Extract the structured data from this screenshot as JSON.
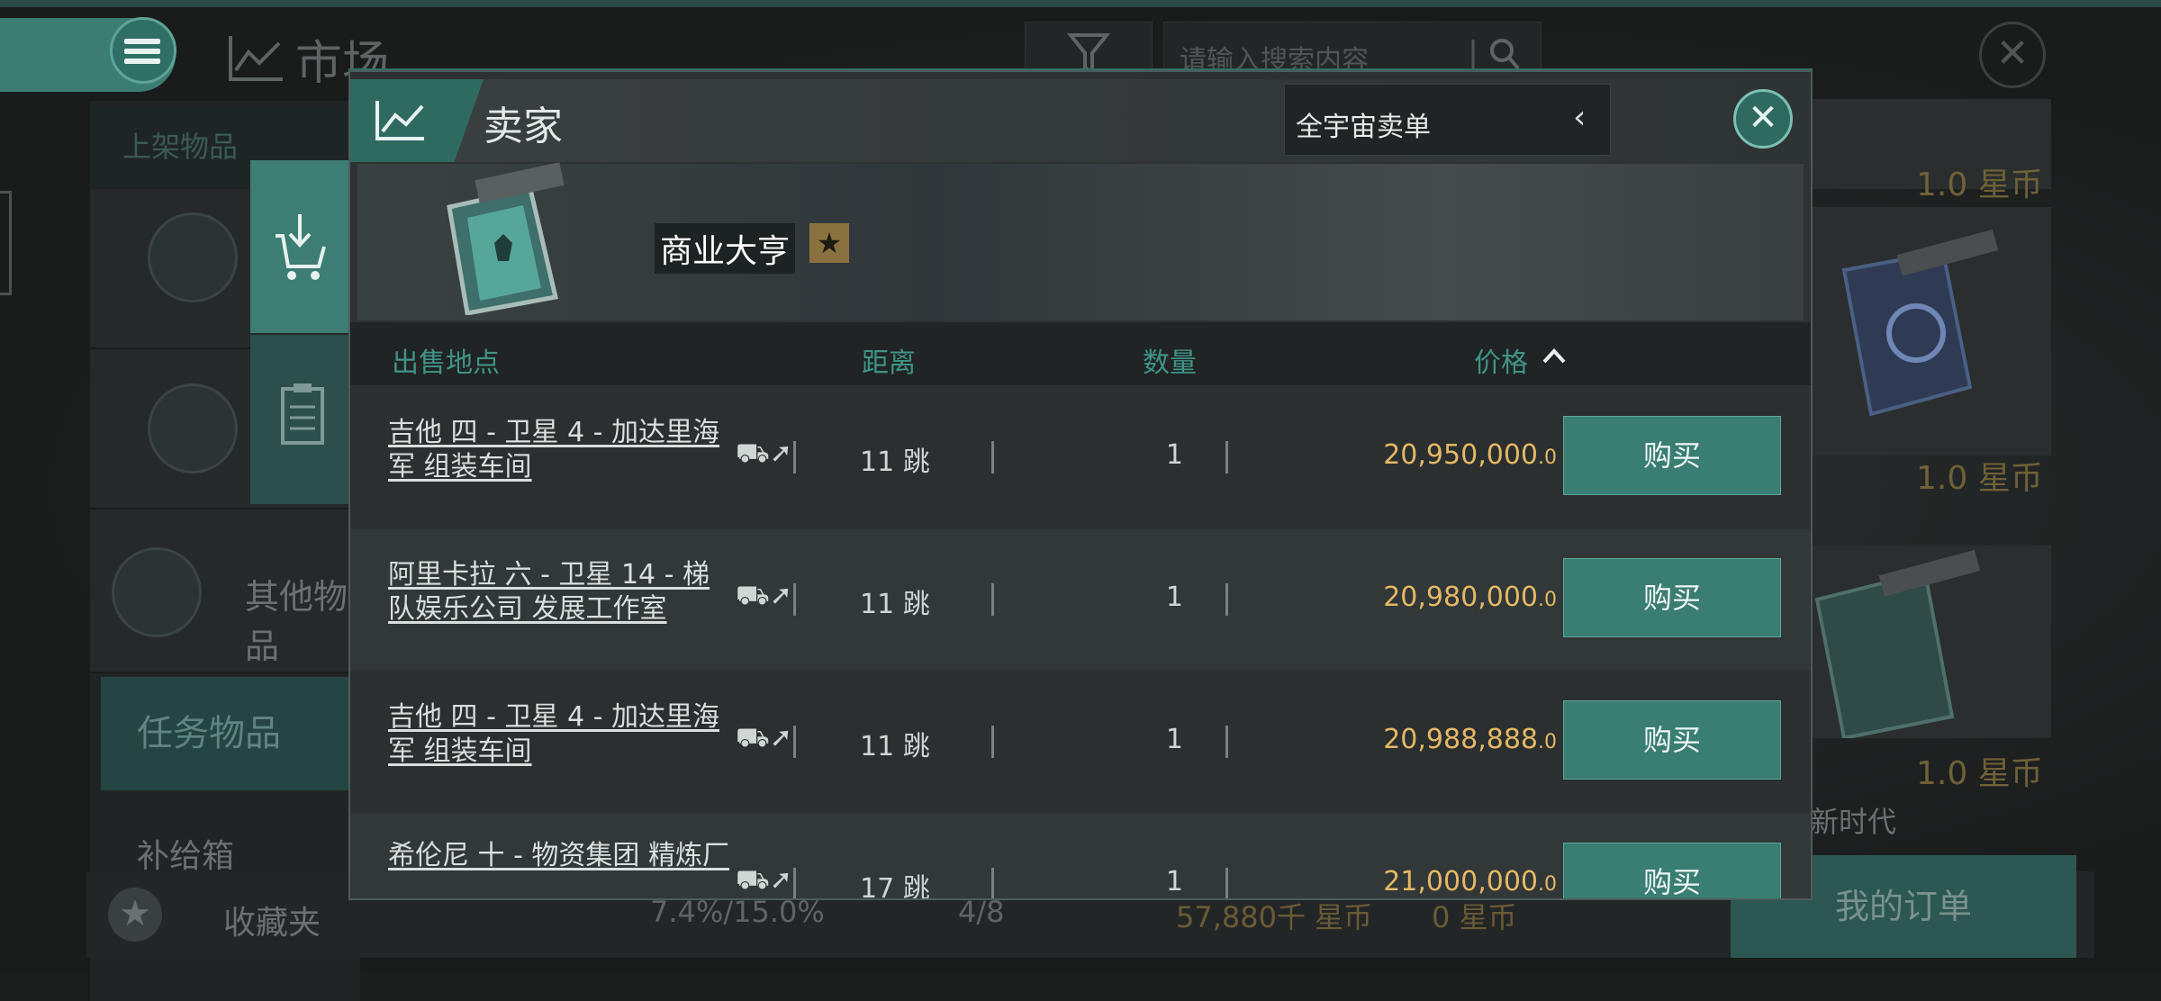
{
  "app": {
    "title": "市场",
    "search": {
      "placeholder": "请输入搜索内容"
    }
  },
  "left_nav": {
    "header": "上架物品",
    "other_items": "其他物品",
    "task_items": "任务物品",
    "supply_box": "补给箱",
    "favorites": "收藏夹"
  },
  "bottom_bar": {
    "tax": "7.4%/15.0%",
    "orders_count": "4/8",
    "balance": "57,880千 星币",
    "escrow": "0 星币",
    "my_orders": "我的订单"
  },
  "right_column": {
    "prices": [
      "1.0 星币",
      "1.0 星币",
      "1.0 星币"
    ],
    "caption": "新时代"
  },
  "dialog": {
    "title": "卖家",
    "scope": "全宇宙卖单",
    "seller": {
      "name": "商业大亨",
      "badge": "★"
    },
    "columns": {
      "location": "出售地点",
      "distance": "距离",
      "quantity": "数量",
      "price": "价格"
    },
    "rows": [
      {
        "location": "吉他 四 - 卫星 4 - 加达里海军 组装车间",
        "jumps": "11 跳",
        "quantity": "1",
        "price_main": "20,950,000",
        "price_dec": ".0",
        "buy": "购买"
      },
      {
        "location": "阿里卡拉 六 - 卫星 14 - 梯队娱乐公司 发展工作室",
        "jumps": "11 跳",
        "quantity": "1",
        "price_main": "20,980,000",
        "price_dec": ".0",
        "buy": "购买"
      },
      {
        "location": "吉他 四 - 卫星 4 - 加达里海军 组装车间",
        "jumps": "11 跳",
        "quantity": "1",
        "price_main": "20,988,888",
        "price_dec": ".0",
        "buy": "购买"
      },
      {
        "location": "希伦尼 十 - 物资集团 精炼厂",
        "jumps": "17 跳",
        "quantity": "1",
        "price_main": "21,000,000",
        "price_dec": ".0",
        "buy": "购买"
      }
    ]
  }
}
